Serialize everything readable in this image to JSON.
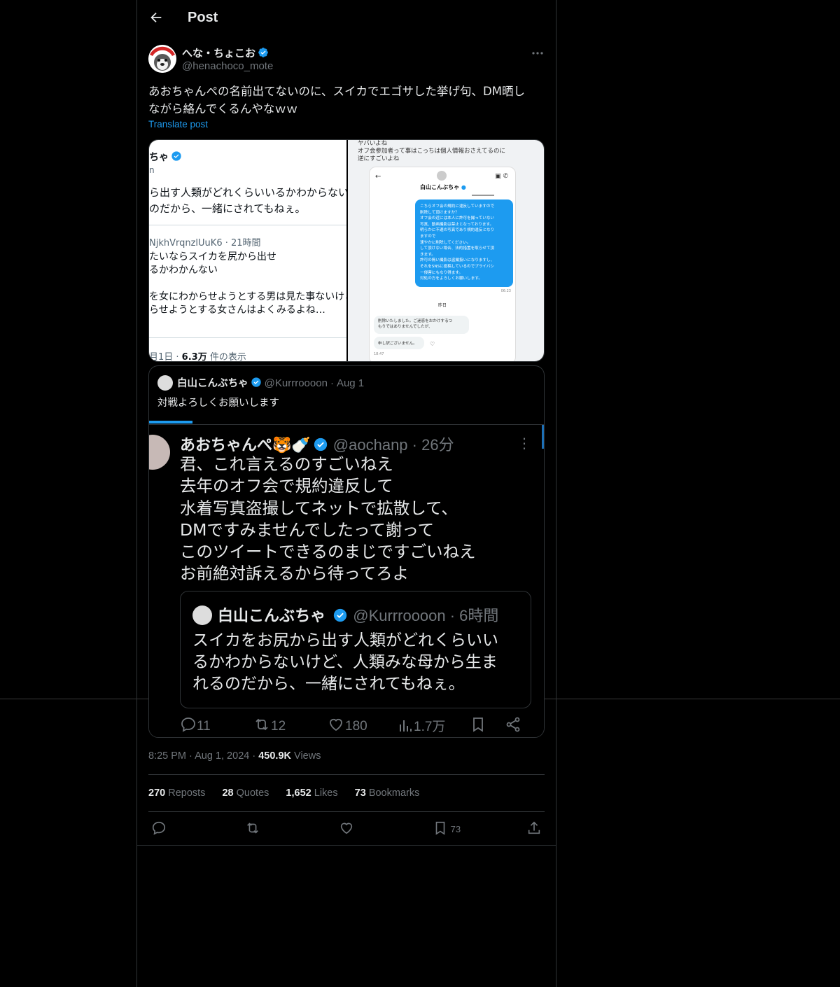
{
  "header": {
    "title": "Post"
  },
  "author": {
    "display_name": "へな・ちょこお",
    "handle": "@henachoco_mote"
  },
  "post": {
    "text": "あおちゃんぺの名前出てないのに、スイカでエゴサした挙げ句、DM晒し\nながら絡んでくるんやなｗｗ",
    "translate_label": "Translate post"
  },
  "media_left": {
    "name": "ちゃ",
    "sub": "n",
    "text1": "ら出す人類がどれくらいいるかわからない\nのだから、一緒にされてもねぇ。",
    "quote_head": "NjkhVrqnzlUuK6 · 21時間",
    "text2": "たいならスイカを尻から出せ\nるかわかんない",
    "text3": "を女にわからせようとする男は見た事ないけど\nらせようとする女さんはよくみるよね…",
    "foot_prefix": "月1日 · ",
    "foot_views": "6.3万",
    "foot_suffix": " 件の表示"
  },
  "media_right": {
    "top_text": "ヤバいよね\nオフ会参加者って事はこっちは個人情報おさえてるのに\n逆にすごいよね",
    "dm_name": "白山こんぶちゃ",
    "bubble_text": "こちらオフ会の規約に違反していますので\n削除して頂けますか？\nオフ会の近には本人に許可を撮っていない\n写真、動画撮影は禁止となっております。\n明らかに不適の写真であり規約違反となり\nますので\n速やかに削除してください。\nして頂けない場合、法的措置を取らせて頂\nきます。\n許可の無い撮影は盗撮扱いになりますし、\nそれをSNSに投稿しているのでプライバシ\nー侵害にもなり得ます。\n対処の方をよろしくお願いします。",
    "time1": "06:23",
    "date_label": "昨日",
    "gray1": "削除いたしました。ご迷惑をおかけするつ\nもりではありませんでしたが、",
    "gray2": "申し訳ございません。",
    "time2": "18:47"
  },
  "quote": {
    "name": "白山こんぶちゃ",
    "handle": "@Kurrroooon",
    "sep": "·",
    "date": "Aug 1",
    "text": "対戦よろしくお願いします"
  },
  "quote_image": {
    "name": "あおちゃんぺ🐯🍼",
    "handle_time": "@aochanp · 26分",
    "body": "君、これ言えるのすごいねえ\n去年のオフ会で規約違反して\n水着写真盗撮してネットで拡散して、\nDMですみませんでしたって謝って\nこのツイートできるのまじですごいねえ\nお前絶対訴えるから待ってろよ",
    "inner_name": "白山こんぶちゃ",
    "inner_handle_time": "@Kurrroooon · 6時間",
    "inner_text": "スイカをお尻から出す人類がどれくらいい\nるかわからないけど、人類みな母から生ま\nれるのだから、一緒にされてもねぇ。",
    "replies": "11",
    "retweets": "12",
    "likes": "180",
    "views": "1.7万"
  },
  "meta": {
    "time": "8:25 PM",
    "date": "Aug 1, 2024",
    "views_count": "450.9K",
    "views_label": "Views",
    "dot": "·"
  },
  "stats": {
    "reposts_count": "270",
    "reposts_label": "Reposts",
    "quotes_count": "28",
    "quotes_label": "Quotes",
    "likes_count": "1,652",
    "likes_label": "Likes",
    "bookmarks_count": "73",
    "bookmarks_label": "Bookmarks"
  },
  "actions": {
    "bookmark_count": "73"
  },
  "colors": {
    "accent": "#1d9bf0",
    "muted": "#71767b",
    "border": "#2f3336"
  }
}
